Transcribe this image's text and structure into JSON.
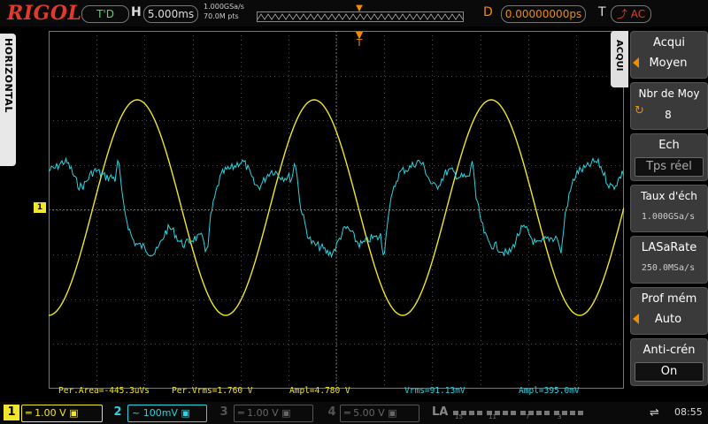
{
  "header": {
    "brand": "RIGOL",
    "trigger_status": "T'D",
    "h_label": "H",
    "timebase": "5.000ms",
    "sample_rate": "1.000GSa/s",
    "memory_depth": "70.0M pts",
    "d_label": "D",
    "delay": "0.00000000ps",
    "t_label": "T",
    "trigger_level": "AC"
  },
  "side_tab": {
    "label": "HORIZONTAL"
  },
  "grid": {
    "ch1_marker": "1",
    "trigger_marker": "T"
  },
  "measurements": [
    "Per.Area=-445.3uVs",
    "Per.Vrms=1.760 V",
    "Ampl=4.780 V",
    "Vrms=91.13mV",
    "Ampl=395.0mV"
  ],
  "menu": {
    "tab_label": "ACQUI",
    "items": [
      {
        "title": "Acqui",
        "value": "Moyen"
      },
      {
        "title": "Nbr de Moy",
        "value": "8"
      },
      {
        "title": "Ech",
        "value": "Tps réel"
      },
      {
        "title": "Taux d'éch",
        "value": "1.000GSa/s"
      },
      {
        "title": "LASaRate",
        "value": "250.0MSa/s"
      },
      {
        "title": "Prof mém",
        "value": "Auto"
      },
      {
        "title": "Anti-crén",
        "value": "On"
      }
    ]
  },
  "channels": [
    {
      "num": "1",
      "setting": "1.00 V",
      "coupling": "═"
    },
    {
      "num": "2",
      "setting": "100mV",
      "coupling": "~"
    },
    {
      "num": "3",
      "setting": "1.00 V",
      "coupling": "═"
    },
    {
      "num": "4",
      "setting": "5.00 V",
      "coupling": "═"
    }
  ],
  "la": {
    "label": "LA",
    "bits": [
      "15",
      "11",
      "7",
      "3"
    ]
  },
  "status": {
    "usb_icon": "usb-icon",
    "time": "08:55"
  },
  "colors": {
    "ch1": "#f2e62a",
    "ch2": "#2ad4e0",
    "accent": "#f08c00",
    "brand": "#e13a2a"
  }
}
